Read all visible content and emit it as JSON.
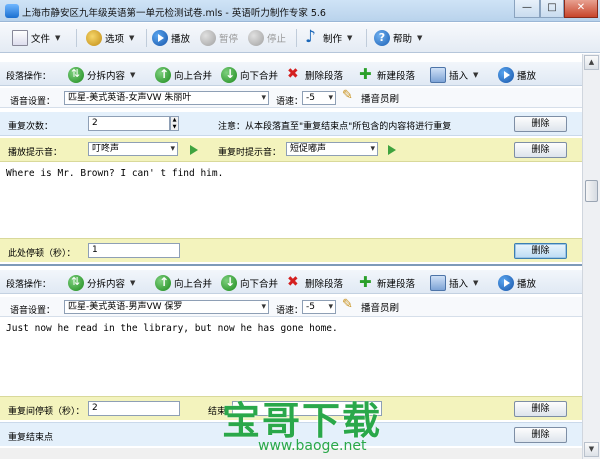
{
  "window": {
    "title": "上海市静安区九年级英语第一单元检测试卷.mls - 英语听力制作专家 5.6",
    "min": "—",
    "max": "□",
    "close": "✕"
  },
  "menubar": {
    "file": "文件",
    "options": "选项",
    "play": "播放",
    "pause": "暂停",
    "stop": "停止",
    "make": "制作",
    "help": "帮助"
  },
  "segment1": {
    "ops_label": "段落操作：",
    "split": "分拆内容",
    "merge_up": "向上合并",
    "merge_down": "向下合并",
    "delete_seg": "删除段落",
    "new_seg": "新建段落",
    "insert": "插入",
    "play": "播放",
    "voice_label": "语音设置：",
    "voice": "匹星-美式英语-女声VW 朱丽叶",
    "speed_label": "语速：",
    "speed": "-5",
    "announcer": "播音员刷",
    "repeat_label": "重复次数：",
    "repeat_value": "2",
    "note": "注意：从本段落直至\"重复结束点\"所包含的内容将进行重复",
    "delete": "删除",
    "cue_label": "播放提示音：",
    "cue_value": "叮咚声",
    "repeat_cue_label": "重复时提示音：",
    "repeat_cue_value": "短促嘟声",
    "text": "Where is Mr. Brown? I can' t find him.",
    "pause_label": "此处停顿（秒）：",
    "pause_value": "1"
  },
  "segment2": {
    "ops_label": "段落操作：",
    "split": "分拆内容",
    "merge_up": "向上合并",
    "merge_down": "向下合并",
    "delete_seg": "删除段落",
    "new_seg": "新建段落",
    "insert": "插入",
    "play": "播放",
    "voice_label": "语音设置：",
    "voice": "匹星-美式英语-男声VW 保罗",
    "speed_label": "语速：",
    "speed": "-5",
    "announcer": "播音员刷",
    "text": "Just now he read in the library, but now he has gone home.",
    "gap_label": "重复间停顿（秒）：",
    "gap_value": "2",
    "end_label": "结束",
    "repeat_end": "重复结束点"
  },
  "watermark": {
    "big": "宝哥下载",
    "url": "www.baoge.net"
  },
  "colors": {
    "accent": "#1a5fb4",
    "note_bg": "#f3f3bd",
    "repeat_bg": "#e4f0fb"
  }
}
